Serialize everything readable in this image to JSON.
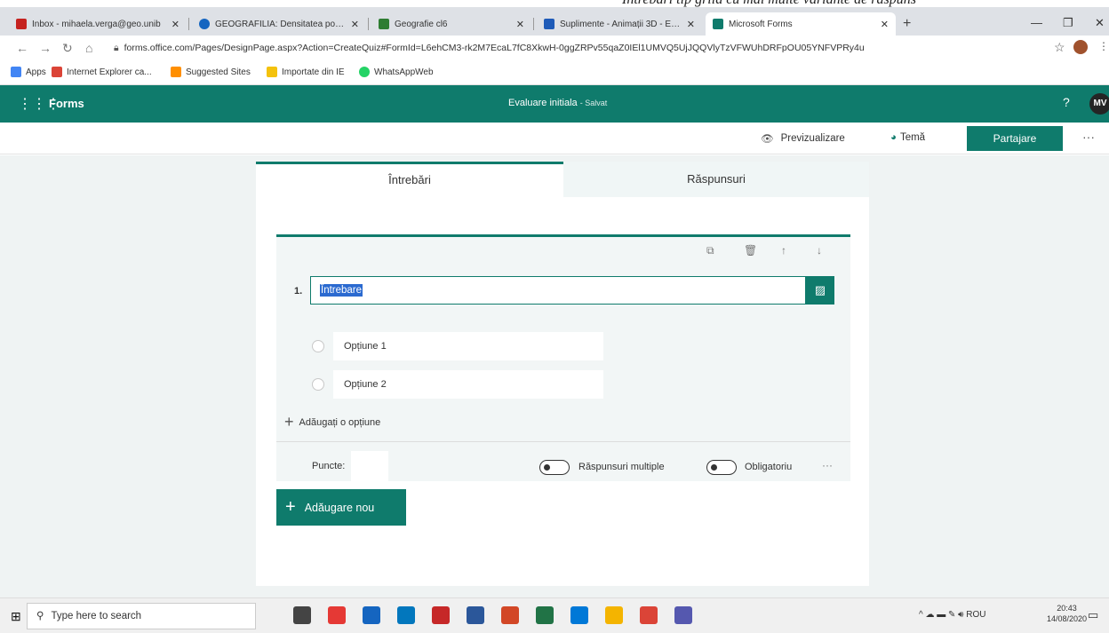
{
  "browser": {
    "tabs": [
      {
        "label": "Inbox - mihaela.verga@geo.unib",
        "color": "#c5221f"
      },
      {
        "label": "GEOGRAFILIA: Densitatea popul",
        "color": "#1565c0"
      },
      {
        "label": "Geografie cl6",
        "color": "#2e7d32"
      },
      {
        "label": "Suplimente - Animații 3D - Educ",
        "color": "#1e5bb8"
      },
      {
        "label": "Microsoft Forms",
        "color": "#0f7b6c"
      }
    ],
    "url": "forms.office.com/Pages/DesignPage.aspx?Action=CreateQuiz#FormId=L6ehCM3-rk2M7EcaL7fC8XkwH-0ggZRPv55qaZ0IEl1UMVQ5UjJQQVlyTzVFWUhDRFpOU05YNFVPRy4u",
    "bookmarks": [
      {
        "label": "Apps",
        "color": "#4285f4"
      },
      {
        "label": "Internet Explorer ca...",
        "color": "#db4437"
      },
      {
        "label": "Suggested Sites",
        "color": "#ff8f00"
      },
      {
        "label": "Importate din IE",
        "color": "#f4c20d"
      },
      {
        "label": "WhatsAppWeb",
        "color": "#25d366"
      }
    ]
  },
  "forms": {
    "brand": "Forms",
    "title": "Evaluare initiala",
    "title_status": "- Salvat",
    "help": "?",
    "avatar": "MV",
    "preview_label": "Previzualizare",
    "theme_label": "Temă",
    "share_label": "Partajare",
    "more": "···",
    "tabs": {
      "questions": "Întrebări",
      "responses": "Răspunsuri"
    },
    "question": {
      "number": "1.",
      "text": "Întrebare",
      "options": [
        "Opțiune 1",
        "Opțiune 2"
      ],
      "add_option": "Adăugați o opțiune",
      "points_label": "Puncte:",
      "points_value": "",
      "multiple_answers": "Răspunsuri multiple",
      "required": "Obligatoriu",
      "more": "···"
    },
    "add_new": "Adăugare nou"
  },
  "taskbar": {
    "search_placeholder": "Type here to search",
    "language": "ROU",
    "time": "20:43",
    "date": "14/08/2020",
    "apps": [
      {
        "name": "task-view",
        "color": "#444444"
      },
      {
        "name": "app-c",
        "color": "#e53935"
      },
      {
        "name": "app-l",
        "color": "#1565c0"
      },
      {
        "name": "app-store",
        "color": "#0277bd"
      },
      {
        "name": "app-mcafee",
        "color": "#c62828"
      },
      {
        "name": "app-word",
        "color": "#2b579a"
      },
      {
        "name": "app-ps",
        "color": "#d24726"
      },
      {
        "name": "app-excel",
        "color": "#217346"
      },
      {
        "name": "app-edge",
        "color": "#0078d7"
      },
      {
        "name": "app-explorer",
        "color": "#f4b400"
      },
      {
        "name": "app-chrome",
        "color": "#db4437"
      },
      {
        "name": "app-teams",
        "color": "#5558af"
      }
    ]
  }
}
